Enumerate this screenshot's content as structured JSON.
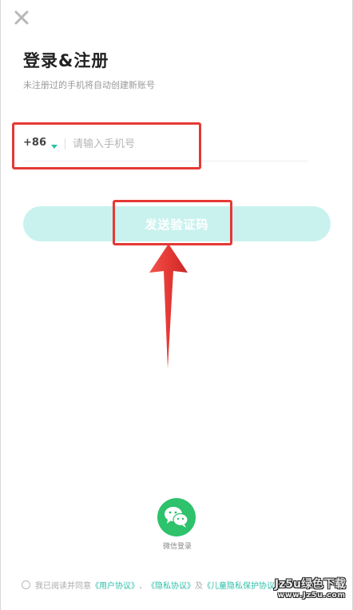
{
  "header": {
    "close_icon": "close-icon",
    "title": "登录&注册",
    "subtitle": "未注册过的手机将自动创建新账号"
  },
  "phone": {
    "country_code": "+86",
    "caret_icon": "chevron-down-icon",
    "value": "",
    "placeholder": "请输入手机号"
  },
  "send_code": {
    "label": "发送验证码"
  },
  "annotation": {
    "highlight_color": "#e53935",
    "arrow_icon": "arrow-up-icon"
  },
  "wechat": {
    "icon": "wechat-icon",
    "label": "微信登录",
    "color": "#2dc26b"
  },
  "agreement": {
    "prefix": "我已阅读并同意",
    "user_agreement": "《用户协议》",
    "sep": "、",
    "privacy_agreement": "《隐私协议》",
    "and": "及",
    "children_agreement": "《儿童隐私保护协议》",
    "link_color": "#2bbfa8"
  },
  "watermark": {
    "main": "Jz5u绿色下载",
    "sub": "www.Jz5u.com"
  },
  "colors": {
    "accent": "#2bbfa8",
    "button_bg": "#c9f2ee"
  }
}
